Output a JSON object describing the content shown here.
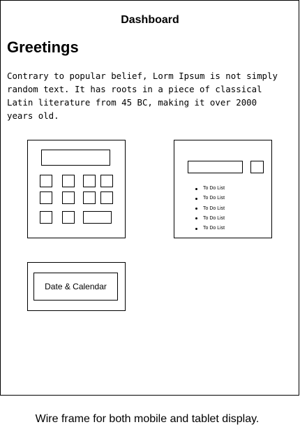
{
  "header": {
    "title": "Dashboard"
  },
  "greeting": {
    "heading": "Greetings",
    "paragraph": "Contrary to popular belief, Lorm Ipsum is not simply\nrandom text. It has roots in a piece of classical\nLatin literature from 45 BC, making it over 2000\nyears old."
  },
  "todo_widget": {
    "items": [
      "To Do List",
      "To Do List",
      "To Do List",
      "To Do List",
      "To Do List"
    ]
  },
  "calendar_widget": {
    "label": "Date & Calendar"
  },
  "caption": "Wire frame for both mobile and tablet display."
}
